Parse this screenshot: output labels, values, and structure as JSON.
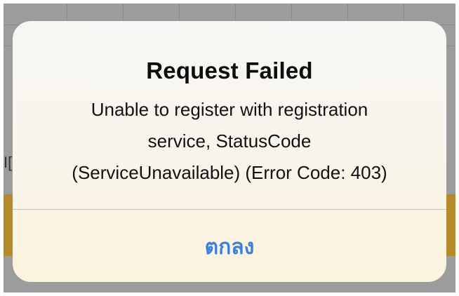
{
  "background": {
    "fragment_text": "I[",
    "band_color": "#b58a28"
  },
  "alert": {
    "title": "Request Failed",
    "message_lines": [
      "Unable to register with registration",
      "service, StatusCode",
      "(ServiceUnavailable) (Error Code: 403)"
    ],
    "button_label": "ตกลง",
    "button_color": "#3a7fdb"
  }
}
